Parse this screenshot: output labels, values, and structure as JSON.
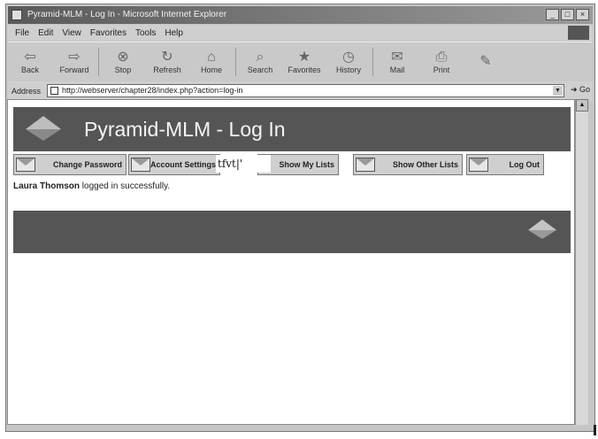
{
  "window": {
    "title": "Pyramid-MLM - Log In - Microsoft Internet Explorer"
  },
  "title_buttons": [
    "_",
    "□",
    "×"
  ],
  "menu": [
    "File",
    "Edit",
    "View",
    "Favorites",
    "Tools",
    "Help"
  ],
  "toolbar": [
    {
      "label": "Back",
      "icon": "back-arrow-icon",
      "glyph": "⇦"
    },
    {
      "label": "Forward",
      "icon": "forward-arrow-icon",
      "glyph": "⇨"
    },
    {
      "label": "Stop",
      "icon": "stop-icon",
      "glyph": "⊗"
    },
    {
      "label": "Refresh",
      "icon": "refresh-icon",
      "glyph": "↻"
    },
    {
      "label": "Home",
      "icon": "home-icon",
      "glyph": "⌂"
    },
    {
      "label": "Search",
      "icon": "search-icon",
      "glyph": "⌕"
    },
    {
      "label": "Favorites",
      "icon": "favorites-icon",
      "glyph": "★"
    },
    {
      "label": "History",
      "icon": "history-icon",
      "glyph": "◷"
    },
    {
      "label": "Mail",
      "icon": "mail-icon",
      "glyph": "✉"
    },
    {
      "label": "Print",
      "icon": "print-icon",
      "glyph": "⎙"
    },
    {
      "label": "",
      "icon": "edit-icon",
      "glyph": "✎"
    }
  ],
  "address": {
    "label": "Address",
    "url": "http://webserver/chapter28/index.php?action=log-in",
    "go_label": "Go"
  },
  "page": {
    "banner_title": "Pyramid-MLM - Log In",
    "nav": [
      "Change Password",
      "Account Settings",
      "Show My Lists",
      "Show Other Lists",
      "Log Out"
    ],
    "overlay_text": "tfvt|'",
    "status_name": "Laura Thomson",
    "status_text": " logged in successfully."
  },
  "colors": {
    "banner": "#555555",
    "chrome": "#c6c6c6"
  }
}
